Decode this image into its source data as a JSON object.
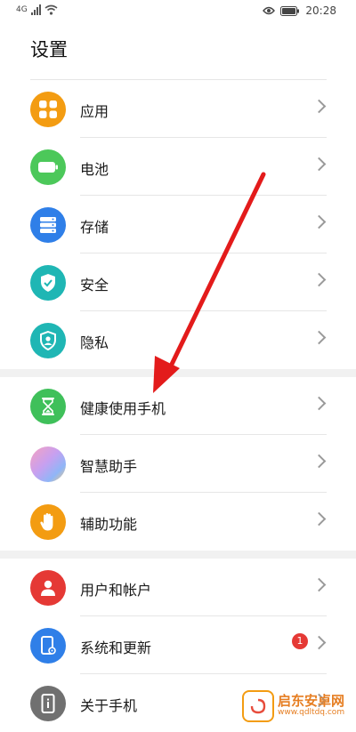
{
  "status_bar": {
    "network": "4G",
    "time": "20:28"
  },
  "header": {
    "title": "设置"
  },
  "groups": [
    {
      "items": [
        {
          "label": "应用",
          "icon": "apps-icon",
          "color": "#f39c12"
        },
        {
          "label": "电池",
          "icon": "battery-icon",
          "color": "#4cc85a"
        },
        {
          "label": "存储",
          "icon": "storage-icon",
          "color": "#2f7fe8"
        },
        {
          "label": "安全",
          "icon": "security-shield-icon",
          "color": "#1fb6b4"
        },
        {
          "label": "隐私",
          "icon": "privacy-icon",
          "color": "#1fb6b4"
        }
      ]
    },
    {
      "items": [
        {
          "label": "健康使用手机",
          "icon": "hourglass-icon",
          "color": "#3fc05a"
        },
        {
          "label": "智慧助手",
          "icon": "assistant-icon",
          "color": "#b48ce8"
        },
        {
          "label": "辅助功能",
          "icon": "hand-icon",
          "color": "#f39c12"
        }
      ]
    },
    {
      "items": [
        {
          "label": "用户和帐户",
          "icon": "user-icon",
          "color": "#e53935"
        },
        {
          "label": "系统和更新",
          "icon": "system-update-icon",
          "color": "#2f7fe8",
          "badge": "1"
        },
        {
          "label": "关于手机",
          "icon": "about-phone-icon",
          "color": "#707070"
        }
      ]
    }
  ],
  "watermark": {
    "title": "启东安卓网",
    "url": "www.qdltdq.com"
  },
  "colors": {
    "arrow": "#e31b1b",
    "separator": "#e6e6e6",
    "group_gap": "#f1f1f1"
  }
}
